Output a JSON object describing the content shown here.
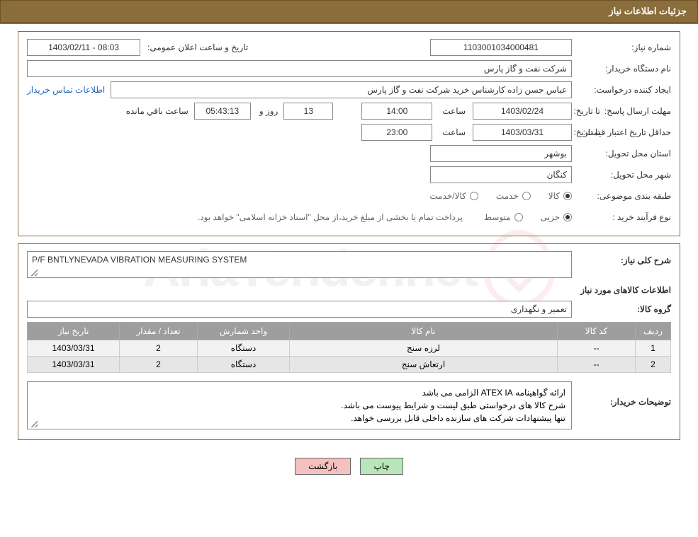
{
  "watermark_text": "AriaTender.net",
  "header": {
    "title": "جزئیات اطلاعات نیاز"
  },
  "fields": {
    "need_no_label": "شماره نیاز:",
    "need_no": "1103001034000481",
    "announce_label": "تاریخ و ساعت اعلان عمومی:",
    "announce_value": "1403/02/11 - 08:03",
    "buyer_org_label": "نام دستگاه خریدار:",
    "buyer_org": "شرکت نفت و گاز پارس",
    "requester_label": "ایجاد کننده درخواست:",
    "requester": "عباس حسن زاده کارشناس خرید شرکت نفت و گاز پارس",
    "contact_link": "اطلاعات تماس خریدار",
    "deadline_label": "مهلت ارسال پاسخ:",
    "to_date_label": "تا تاریخ:",
    "deadline_date": "1403/02/24",
    "time_label": "ساعت",
    "deadline_time": "14:00",
    "days_value": "13",
    "days_and": "روز و",
    "countdown": "05:43:13",
    "remaining": "ساعت باقي مانده",
    "price_valid_label": "حداقل تاریخ اعتبار قیمت:",
    "price_valid_date": "1403/03/31",
    "price_valid_time": "23:00",
    "delivery_province_label": "استان محل تحویل:",
    "delivery_province": "بوشهر",
    "delivery_city_label": "شهر محل تحویل:",
    "delivery_city": "کنگان",
    "subject_class_label": "طبقه بندی موضوعی:",
    "radio_goods": "کالا",
    "radio_service": "خدمت",
    "radio_goods_service": "کالا/خدمت",
    "purchase_type_label": "نوع فرآیند خرید :",
    "radio_partial": "جزیی",
    "radio_medium": "متوسط",
    "purchase_note": "پرداخت تمام یا بخشی از مبلغ خرید،از محل \"اسناد خزانه اسلامی\" خواهد بود."
  },
  "need": {
    "overall_label": "شرح کلی نیاز:",
    "overall_value": "P/F  BNTLYNEVADA  VIBRATION MEASURING SYSTEM",
    "items_title": "اطلاعات کالاهای مورد نیاز",
    "group_label": "گروه کالا:",
    "group_value": "تعمیر و نگهداری"
  },
  "table": {
    "headers": [
      "ردیف",
      "کد کالا",
      "نام کالا",
      "واحد شمارش",
      "تعداد / مقدار",
      "تاریخ نیاز"
    ],
    "rows": [
      {
        "idx": "1",
        "code": "--",
        "name": "لرزه سنج",
        "unit": "دستگاه",
        "qty": "2",
        "date": "1403/03/31"
      },
      {
        "idx": "2",
        "code": "--",
        "name": "ارتعاش سنج",
        "unit": "دستگاه",
        "qty": "2",
        "date": "1403/03/31"
      }
    ]
  },
  "buyer_notes": {
    "label": "توضیحات خریدار:",
    "line1": "ارائه گواهینامه ATEX IA الزامی می باشد",
    "line2": "شرح کالا های درخواستی طبق لیست و شرایط پیوست می باشد.",
    "line3": "تنها پیشنهادات شرکت های سازنده داخلی قابل بررسی خواهد."
  },
  "buttons": {
    "print": "چاپ",
    "back": "بازگشت"
  }
}
